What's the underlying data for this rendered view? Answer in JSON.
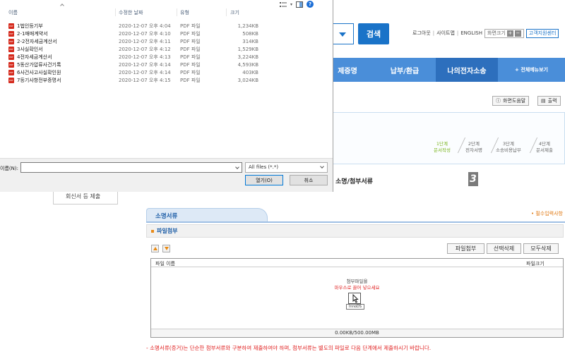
{
  "header": {
    "search_label": "검색",
    "util_links": [
      "로그아웃",
      "사이트맵",
      "ENGLISH"
    ],
    "font_size_label": "화면크기",
    "help_center_label": "고객지원센터"
  },
  "gnb": {
    "items": [
      "제증명",
      "납부/환급",
      "나의전자소송"
    ],
    "all_menu_label": "+ 전체메뉴보기"
  },
  "tools": {
    "screen_help": "화면도움말",
    "print": "출력"
  },
  "steps": [
    {
      "num": "1단계",
      "label": "문서작성"
    },
    {
      "num": "2단계",
      "label": "전자서명"
    },
    {
      "num": "3단계",
      "label": "소송비용납부"
    },
    {
      "num": "4단계",
      "label": "문서제출"
    }
  ],
  "section": {
    "title": "소명/첨부서류",
    "step_number": "3"
  },
  "left_menu": {
    "item": "회신서 등 제출"
  },
  "tab": {
    "label": "소명서류",
    "required_note": "• 필수입력사항"
  },
  "attach": {
    "header": "파일첨부",
    "buttons": [
      "파일첨부",
      "선택삭제",
      "모두삭제"
    ],
    "col_name": "파일 이름",
    "col_size": "파일크기",
    "drop_line1": "첨부파일을",
    "drop_line2": "마우스로 끌어 넣으세요",
    "drag_label": "InnoDS",
    "capacity": "0.00KB/500.00MB"
  },
  "notice": "- 소명서류(증거)는 단순한 첨부서류와 구분하여 제출하여야 하며, 첨부서류는 별도의 파일로 다음 단계에서 제출하시기 바랍니다.",
  "dialog": {
    "columns": [
      "이름",
      "수정한 날짜",
      "유형",
      "크기"
    ],
    "files": [
      {
        "name": "1법인등기부",
        "date": "2020-12-07 오후 4:04",
        "type": "PDF 파일",
        "size": "1,234KB"
      },
      {
        "name": "2-1매매계약서",
        "date": "2020-12-07 오후 4:10",
        "type": "PDF 파일",
        "size": "508KB"
      },
      {
        "name": "2-2전자세금계산서",
        "date": "2020-12-07 오후 4:11",
        "type": "PDF 파일",
        "size": "314KB"
      },
      {
        "name": "3사실확인서",
        "date": "2020-12-07 오후 4:12",
        "type": "PDF 파일",
        "size": "1,529KB"
      },
      {
        "name": "4전자세금계산서",
        "date": "2020-12-07 오후 4:13",
        "type": "PDF 파일",
        "size": "3,224KB"
      },
      {
        "name": "5동산가압류사건기록",
        "date": "2020-12-07 오후 4:14",
        "type": "PDF 파일",
        "size": "4,593KB"
      },
      {
        "name": "6사건사고사실확인원",
        "date": "2020-12-07 오후 4:14",
        "type": "PDF 파일",
        "size": "403KB"
      },
      {
        "name": "7등기사항전부증명서",
        "date": "2020-12-07 오후 4:15",
        "type": "PDF 파일",
        "size": "3,024KB"
      }
    ],
    "filename_label": "이름(N):",
    "filename_value": "",
    "filetype": "All files (*.*)",
    "open_button": "열기(O)",
    "cancel_button": "취소"
  }
}
